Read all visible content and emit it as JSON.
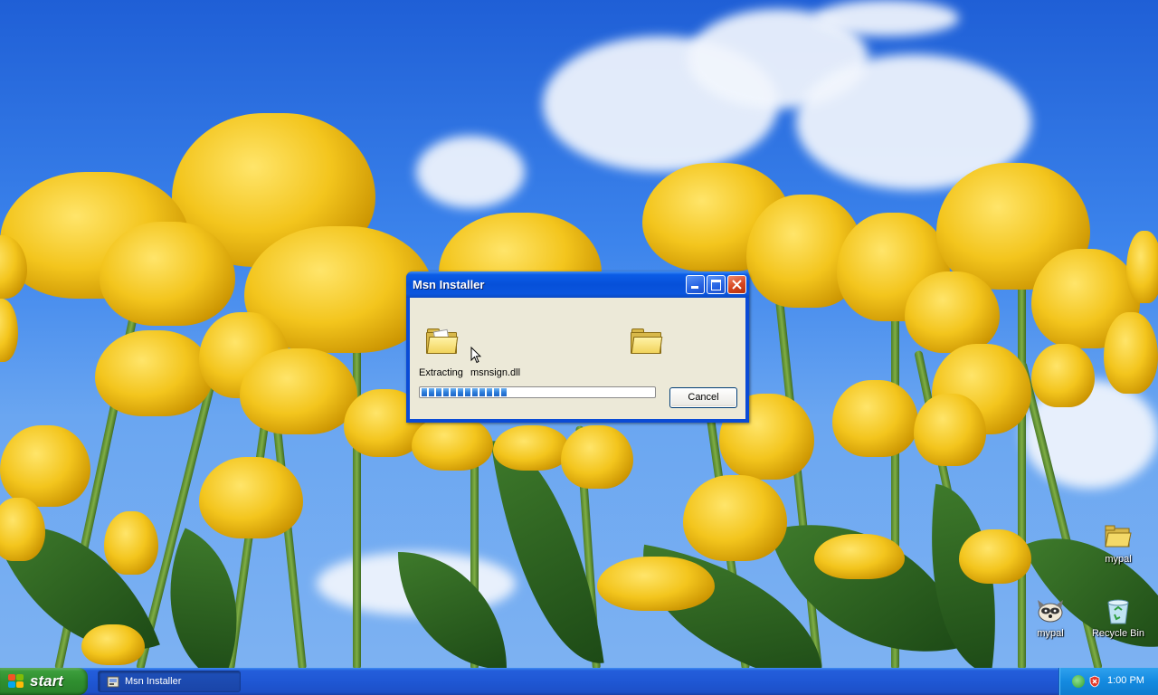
{
  "desktop": {
    "icons": [
      {
        "label": "mypal",
        "icon": "folder-icon"
      },
      {
        "label": "mypal",
        "icon": "raccoon-icon"
      },
      {
        "label": "Recycle Bin",
        "icon": "recycle-bin-icon"
      }
    ]
  },
  "dialog": {
    "title": "Msn Installer",
    "status_action": "Extracting",
    "status_file": "msnsign.dll",
    "progress": 0.4,
    "cancel_label": "Cancel",
    "source_icon": "folder-open-icon",
    "dest_icon": "folder-icon"
  },
  "taskbar": {
    "start_label": "start",
    "tasks": [
      {
        "label": "Msn Installer",
        "icon": "installer-icon"
      }
    ],
    "clock": "1:00 PM",
    "tray_icons": [
      "network-icon",
      "security-alert-icon"
    ]
  },
  "colors": {
    "title_bar": "#0650d9",
    "start_button": "#2f8e2f",
    "progress_fill": "#2f7fdc",
    "dialog_face": "#ece9d8"
  }
}
